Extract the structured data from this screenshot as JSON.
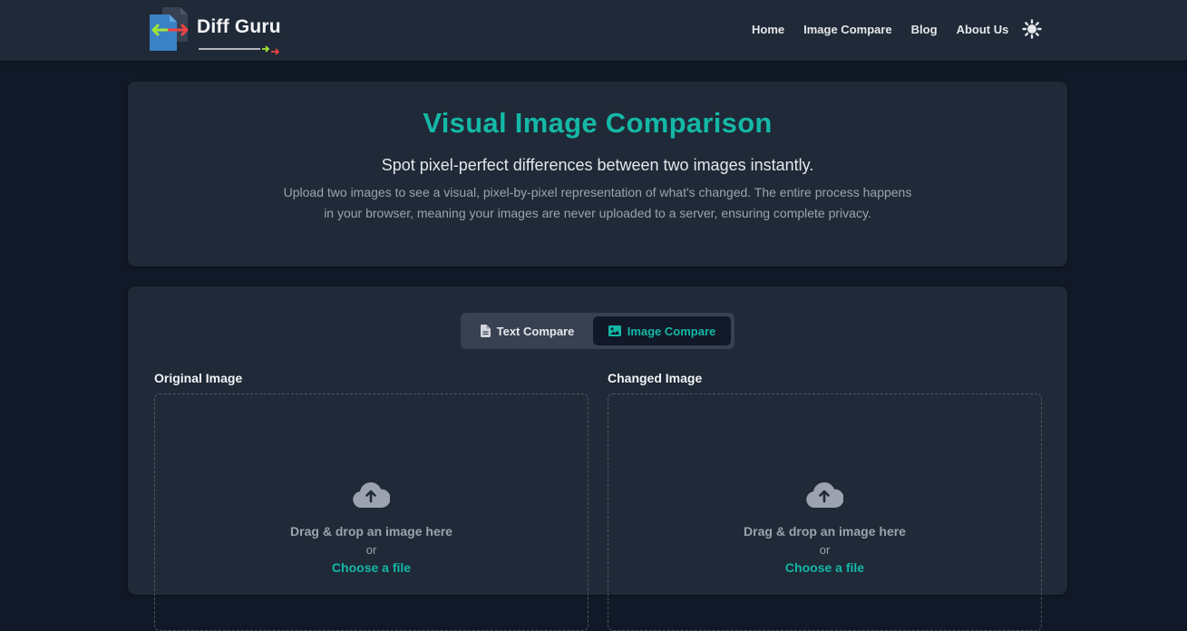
{
  "brand": {
    "name": "Diff Guru",
    "icon": "diff-guru-logo-icon"
  },
  "nav": {
    "links": [
      {
        "label": "Home"
      },
      {
        "label": "Image Compare"
      },
      {
        "label": "Blog"
      },
      {
        "label": "About Us"
      }
    ],
    "theme_icon": "sun-icon"
  },
  "hero": {
    "title": "Visual Image Comparison",
    "subtitle": "Spot pixel-perfect differences between two images instantly.",
    "description": "Upload two images to see a visual, pixel-by-pixel representation of what's changed. The entire process happens in your browser, meaning your images are never uploaded to a server, ensuring complete privacy."
  },
  "tabs": [
    {
      "label": "Text Compare",
      "icon": "document-icon",
      "active": false
    },
    {
      "label": "Image Compare",
      "icon": "image-icon",
      "active": true
    }
  ],
  "panels": {
    "original": {
      "label": "Original Image",
      "drop_text": "Drag & drop an image here",
      "or_text": "or",
      "choose_text": "Choose a file"
    },
    "changed": {
      "label": "Changed Image",
      "drop_text": "Drag & drop an image here",
      "or_text": "or",
      "choose_text": "Choose a file"
    }
  },
  "colors": {
    "accent": "#14b8a6",
    "page_bg": "#111827",
    "card_bg": "#1f2937",
    "nav_bg": "#1f2937"
  }
}
